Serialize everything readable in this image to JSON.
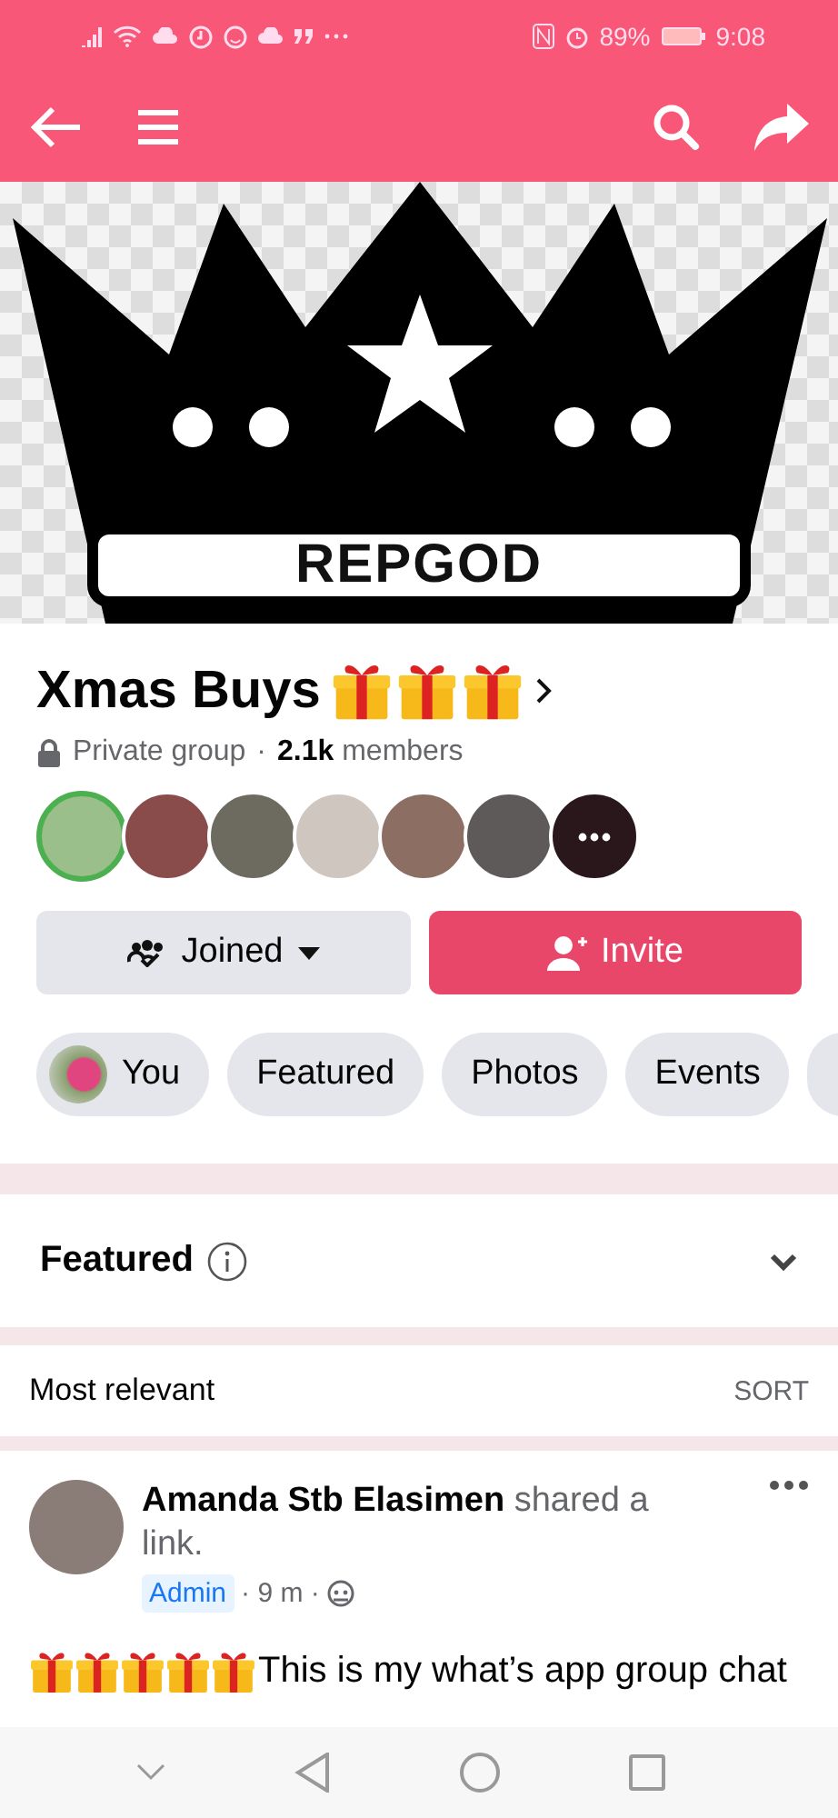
{
  "status_bar": {
    "battery": "89%",
    "time": "9:08"
  },
  "cover": {
    "badge_text": "REPGOD"
  },
  "group": {
    "name": "Xmas Buys",
    "privacy": "Private group",
    "separator": "·",
    "members": "**2.1k** members"
  },
  "actions": [
    {
      "kind": "joined",
      "label": "Joined"
    },
    {
      "kind": "invite",
      "label": "Invite"
    }
  ],
  "chips": [
    {
      "label": "You",
      "kind": "avatar"
    },
    {
      "label": "Featured",
      "kind": "plain"
    },
    {
      "label": "Photos",
      "kind": "plain"
    },
    {
      "label": "Events",
      "kind": "plain"
    },
    {
      "kind": "cut"
    }
  ],
  "featured": {
    "title": "Featured",
    "expanded": false
  },
  "sort_bar": {
    "label": "Most relevant",
    "action": "SORT"
  },
  "post": {
    "author": "Amanda Stb Elasimen",
    "activity": "shared a link.",
    "badge": "Admin",
    "time": "· 9 m ·",
    "text": "This is my what’s app group chat"
  }
}
